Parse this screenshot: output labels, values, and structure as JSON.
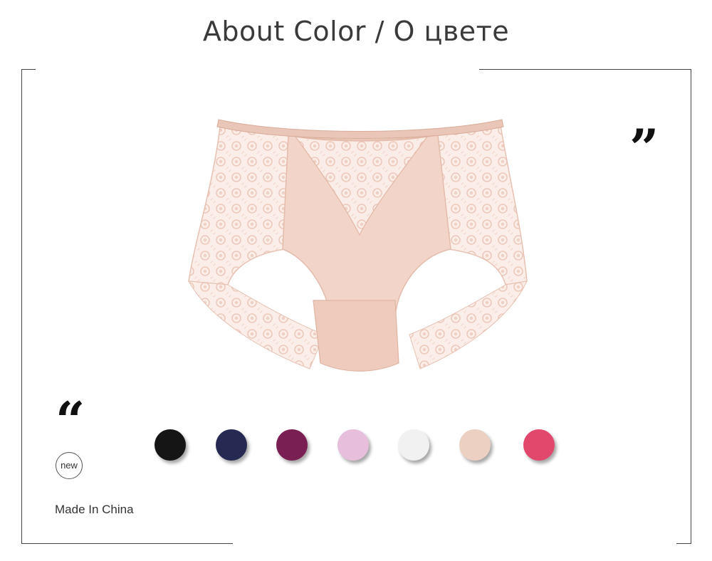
{
  "header": {
    "title": "About Color / О цвете"
  },
  "product": {
    "image_name": "lace-briefs-photo",
    "color": "#f2d4c8"
  },
  "decor": {
    "open_quote": "“",
    "close_quote": "”"
  },
  "badge": {
    "label": "new"
  },
  "footer": {
    "origin": "Made In China"
  },
  "swatches": [
    {
      "name": "black",
      "hex": "#151515"
    },
    {
      "name": "navy",
      "hex": "#262a52"
    },
    {
      "name": "wine",
      "hex": "#7a1f53"
    },
    {
      "name": "lilac",
      "hex": "#e8bedd"
    },
    {
      "name": "white",
      "hex": "#f1f1f1"
    },
    {
      "name": "nude",
      "hex": "#ecd0c2"
    },
    {
      "name": "rose",
      "hex": "#e2476c"
    }
  ]
}
